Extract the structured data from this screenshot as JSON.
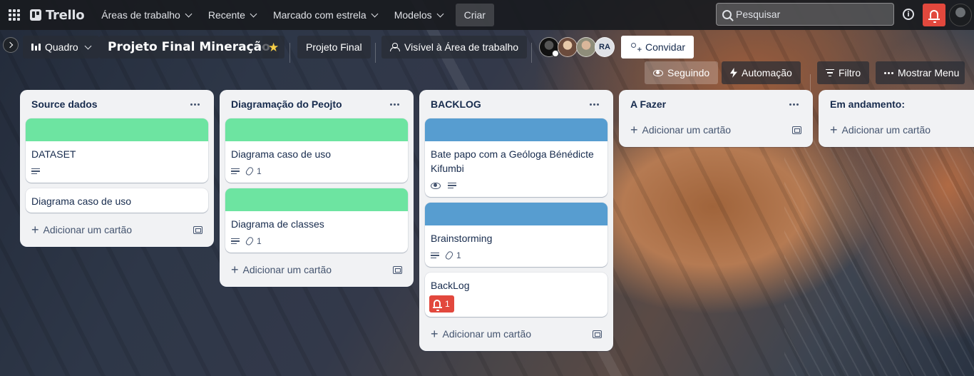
{
  "topbar": {
    "logo": "Trello",
    "nav": [
      "Áreas de trabalho",
      "Recente",
      "Marcado com estrela",
      "Modelos"
    ],
    "create_label": "Criar",
    "search_placeholder": "Pesquisar",
    "info_glyph": "i"
  },
  "board": {
    "view_label": "Quadro",
    "title": "Projeto Final Mineração",
    "tag_label": "Projeto Final",
    "visibility_label": "Visível à Área de trabalho",
    "member_initials": "RA",
    "invite_label": "Convidar",
    "watch_label": "Seguindo",
    "automation_label": "Automação",
    "filter_label": "Filtro",
    "menu_label": "Mostrar Menu"
  },
  "common": {
    "add_card_label": "Adicionar um cartão"
  },
  "lists": [
    {
      "title": "Source dados",
      "cards": [
        {
          "title": "DATASET",
          "cover": "green"
        },
        {
          "title": "Diagrama caso de uso"
        }
      ]
    },
    {
      "title": "Diagramação do Peojto",
      "cards": [
        {
          "title": "Diagrama caso de uso",
          "cover": "green",
          "attachments": "1"
        },
        {
          "title": "Diagrama de classes",
          "cover": "green",
          "attachments": "1"
        }
      ]
    },
    {
      "title": "BACKLOG",
      "cards": [
        {
          "title": "Bate papo com a Geóloga Bénédicte Kifumbi",
          "cover": "blue"
        },
        {
          "title": "Brainstorming",
          "cover": "blue",
          "attachments": "1"
        },
        {
          "title": "BackLog",
          "notifications": "1"
        }
      ]
    },
    {
      "title": "A Fazer",
      "cards": []
    },
    {
      "title": "Em andamento:",
      "cards": []
    }
  ],
  "colors": {
    "cover_green": "#6de4a1",
    "cover_blue": "#579dd0",
    "notification_red": "#e2483d"
  },
  "icons": [
    "apps-grid-icon",
    "trello-logo-icon",
    "chevron-down-icon",
    "search-icon",
    "info-icon",
    "bell-icon",
    "star-icon",
    "board-view-icon",
    "workspace-visibility-icon",
    "add-member-icon",
    "eye-icon",
    "bolt-icon",
    "filter-icon",
    "more-icon",
    "description-icon",
    "attachment-icon",
    "plus-icon",
    "template-icon"
  ]
}
